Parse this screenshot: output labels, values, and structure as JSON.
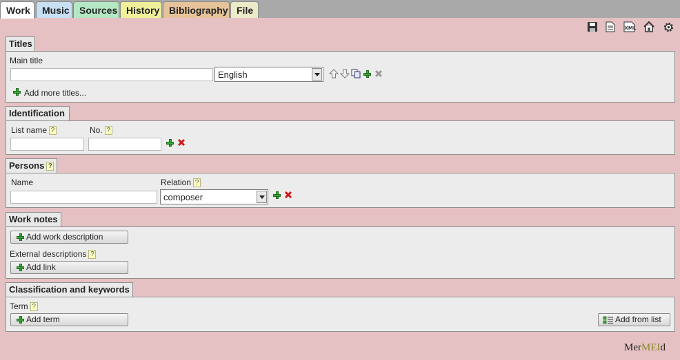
{
  "tabs": [
    {
      "label": "Work",
      "color": "#ffffff"
    },
    {
      "label": "Music",
      "color": "#c7e0f4"
    },
    {
      "label": "Sources",
      "color": "#b4e8c4"
    },
    {
      "label": "History",
      "color": "#f1f09a"
    },
    {
      "label": "Bibliography",
      "color": "#e6c399"
    },
    {
      "label": "File",
      "color": "#ebebc9"
    }
  ],
  "toolbar": {
    "icons": [
      "save-icon",
      "html-document-icon",
      "xml-icon",
      "home-icon",
      "settings-gear-icon"
    ],
    "xml_text": "XML"
  },
  "titles": {
    "legend": "Titles",
    "main_title_label": "Main title",
    "main_title_value": "",
    "language": "English",
    "add_more": "Add more titles..."
  },
  "identification": {
    "legend": "Identification",
    "list_name_label": "List name",
    "no_label": "No.",
    "help": "?"
  },
  "persons": {
    "legend": "Persons",
    "name_label": "Name",
    "relation_label": "Relation",
    "relation_value": "composer",
    "help": "?"
  },
  "work_notes": {
    "legend": "Work notes",
    "add_description": "Add work description",
    "external_label": "External descriptions",
    "add_link": "Add link",
    "help": "?"
  },
  "classification": {
    "legend": "Classification and keywords",
    "term_label": "Term",
    "add_term": "Add term",
    "add_from_list": "Add from list",
    "help": "?"
  },
  "logo": {
    "part1": "Mer",
    "part2": "MEI",
    "part3": "d"
  }
}
